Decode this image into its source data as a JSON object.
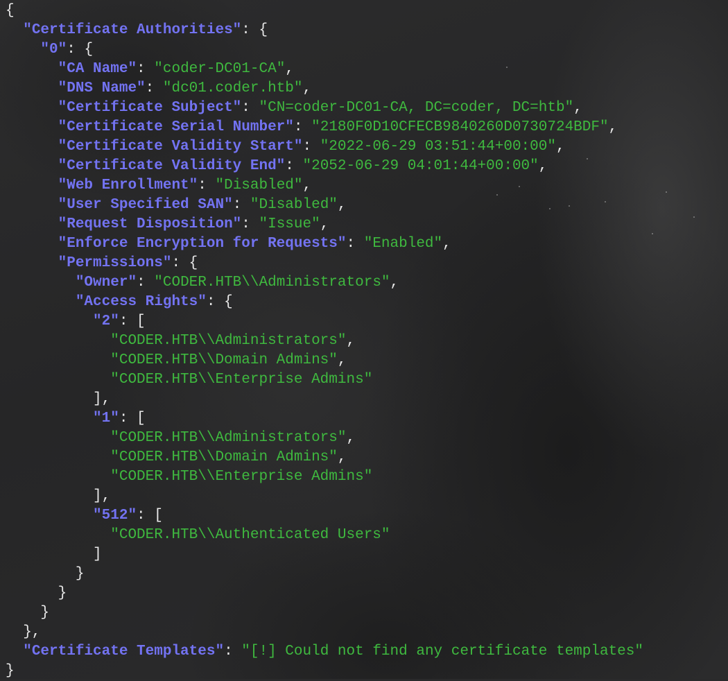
{
  "output": {
    "keys": {
      "certificate_authorities": "\"Certificate Authorities\"",
      "index0": "\"0\"",
      "ca_name": "\"CA Name\"",
      "dns_name": "\"DNS Name\"",
      "cert_subject": "\"Certificate Subject\"",
      "cert_serial": "\"Certificate Serial Number\"",
      "validity_start": "\"Certificate Validity Start\"",
      "validity_end": "\"Certificate Validity End\"",
      "web_enrollment": "\"Web Enrollment\"",
      "user_specified_san": "\"User Specified SAN\"",
      "request_disposition": "\"Request Disposition\"",
      "enforce_encryption": "\"Enforce Encryption for Requests\"",
      "permissions": "\"Permissions\"",
      "owner": "\"Owner\"",
      "access_rights": "\"Access Rights\"",
      "right_2": "\"2\"",
      "right_1": "\"1\"",
      "right_512": "\"512\"",
      "certificate_templates": "\"Certificate Templates\""
    },
    "values": {
      "ca_name": "\"coder-DC01-CA\"",
      "dns_name": "\"dc01.coder.htb\"",
      "cert_subject": "\"CN=coder-DC01-CA, DC=coder, DC=htb\"",
      "cert_serial": "\"2180F0D10CFECB9840260D0730724BDF\"",
      "validity_start": "\"2022-06-29 03:51:44+00:00\"",
      "validity_end": "\"2052-06-29 04:01:44+00:00\"",
      "web_enrollment": "\"Disabled\"",
      "user_specified_san": "\"Disabled\"",
      "request_disposition": "\"Issue\"",
      "enforce_encryption": "\"Enabled\"",
      "owner": "\"CODER.HTB\\\\Administrators\"",
      "rights_2": [
        "\"CODER.HTB\\\\Administrators\"",
        "\"CODER.HTB\\\\Domain Admins\"",
        "\"CODER.HTB\\\\Enterprise Admins\""
      ],
      "rights_1": [
        "\"CODER.HTB\\\\Administrators\"",
        "\"CODER.HTB\\\\Domain Admins\"",
        "\"CODER.HTB\\\\Enterprise Admins\""
      ],
      "rights_512": [
        "\"CODER.HTB\\\\Authenticated Users\""
      ],
      "certificate_templates": "\"[!] Could not find any certificate templates\""
    }
  },
  "colors": {
    "key": "#7373f2",
    "string": "#3fb93f",
    "punctuation": "#e8e8e8",
    "background": "#2a2a2b"
  }
}
